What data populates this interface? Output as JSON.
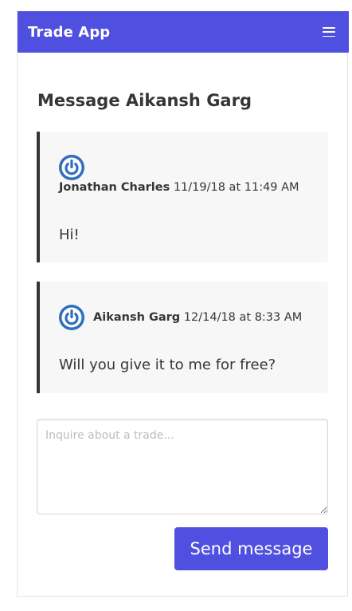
{
  "navbar": {
    "brand": "Trade App",
    "menu_icon": "hamburger-menu-icon",
    "color": "#5050e0"
  },
  "page": {
    "title": "Message Aikansh Garg"
  },
  "messages": [
    {
      "author": "Jonathan Charles",
      "timestamp": "11/19/18 at 11:49 AM",
      "text": "Hi!",
      "avatar_icon": "power-icon"
    },
    {
      "author": "Aikansh Garg",
      "timestamp": "12/14/18 at 8:33 AM",
      "text": "Will you give it to me for free?",
      "avatar_icon": "power-icon"
    }
  ],
  "composer": {
    "placeholder": "Inquire about a trade...",
    "value": ""
  },
  "send_button": {
    "label": "Send message"
  }
}
